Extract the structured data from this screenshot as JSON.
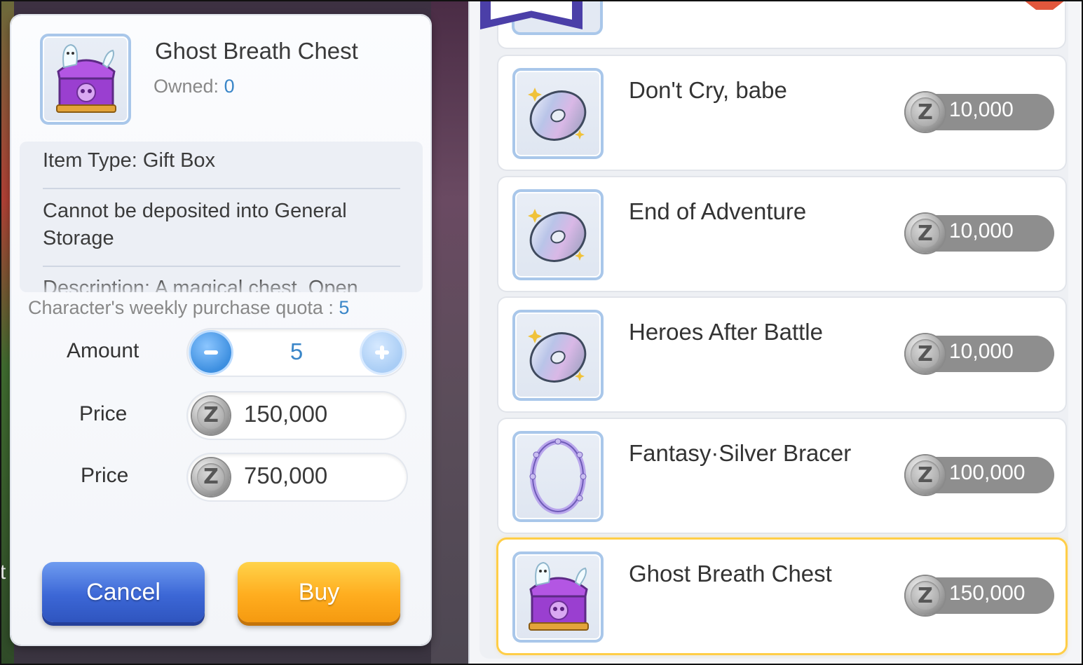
{
  "dialog": {
    "title": "Ghost Breath Chest",
    "owned_label": "Owned: ",
    "owned_value": "0",
    "item_type": "Item Type: Gift Box",
    "storage_note_line1": "Cannot be deposited into General",
    "storage_note_line2": "Storage",
    "description": "Description: A magical chest. Open",
    "quota_label": "Character's weekly purchase quota : ",
    "quota_value": "5",
    "amount_label": "Amount",
    "amount_value": "5",
    "price_label_1": "Price",
    "price_value_1": "150,000",
    "price_label_2": "Price",
    "price_value_2": "750,000",
    "currency_symbol": "Z",
    "cancel_label": "Cancel",
    "buy_label": "Buy"
  },
  "shop": {
    "items": [
      {
        "name": "Don't Cry, babe",
        "price": "10,000",
        "icon": "music-disc-icon"
      },
      {
        "name": "End of Adventure",
        "price": "10,000",
        "icon": "music-disc-icon"
      },
      {
        "name": "Heroes After Battle",
        "price": "10,000",
        "icon": "music-disc-icon"
      },
      {
        "name": "Fantasy·Silver Bracer",
        "price": "100,000",
        "icon": "bracer-icon"
      },
      {
        "name": "Ghost Breath Chest",
        "price": "150,000",
        "icon": "ghost-chest-icon",
        "selected": true
      }
    ]
  },
  "colors": {
    "accent_blue": "#3a86c8",
    "cancel_button": "#3c67d6",
    "buy_button": "#ffad1f",
    "selected_border": "#ffce47",
    "price_pill": "#8e8e8e"
  }
}
